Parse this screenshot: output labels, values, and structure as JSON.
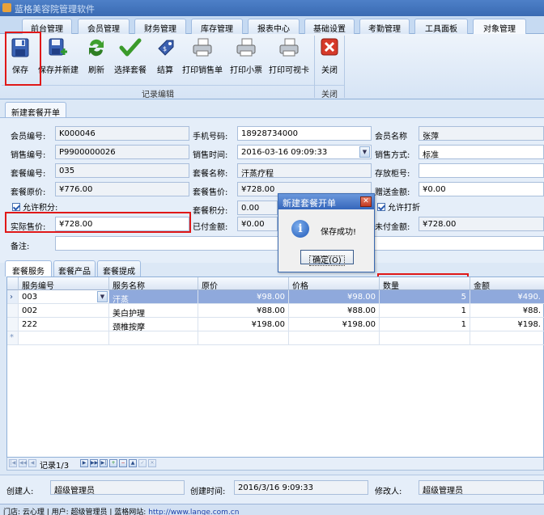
{
  "window": {
    "title": "蓝格美容院管理软件"
  },
  "menu_tabs": [
    "前台管理",
    "会员管理",
    "财务管理",
    "库存管理",
    "报表中心",
    "基础设置",
    "考勤管理",
    "工具面板",
    "对象管理"
  ],
  "ribbon": {
    "buttons": [
      {
        "label": "保存",
        "icon": "save-icon"
      },
      {
        "label": "保存并新建",
        "icon": "save-new-icon"
      },
      {
        "label": "刷新",
        "icon": "refresh-icon"
      },
      {
        "label": "选择套餐",
        "icon": "check-icon"
      },
      {
        "label": "结算",
        "icon": "settle-tag-icon"
      },
      {
        "label": "打印销售单",
        "icon": "printer-icon"
      },
      {
        "label": "打印小票",
        "icon": "printer-icon"
      },
      {
        "label": "打印可视卡",
        "icon": "printer-icon"
      },
      {
        "label": "关闭",
        "icon": "close-icon"
      }
    ],
    "groups": [
      "记录编辑",
      "关闭"
    ]
  },
  "doc_tab": "新建套餐开单",
  "form": {
    "member_no": {
      "label": "会员编号:",
      "value": "K000046"
    },
    "phone": {
      "label": "手机号码:",
      "value": "18928734000"
    },
    "member_name": {
      "label": "会员名称",
      "value": "张萍"
    },
    "sale_no": {
      "label": "销售编号:",
      "value": "P9900000026"
    },
    "sale_time": {
      "label": "销售时间:",
      "value": "2016-03-16 09:09:33"
    },
    "sale_method": {
      "label": "销售方式:",
      "value": "标准"
    },
    "package_no": {
      "label": "套餐编号:",
      "value": "035"
    },
    "package_name": {
      "label": "套餐名称:",
      "value": "汗蒸疗程"
    },
    "cabinet_no": {
      "label": "存放柜号:",
      "value": ""
    },
    "orig_price": {
      "label": "套餐原价:",
      "value": "¥776.00"
    },
    "sale_price": {
      "label": "套餐售价:",
      "value": "¥728.00"
    },
    "gift_amount": {
      "label": "赠送金额:",
      "value": "¥0.00"
    },
    "allow_points": {
      "label": "允许积分:"
    },
    "package_points": {
      "label": "套餐积分:",
      "value": "0.00"
    },
    "allow_discount": {
      "label": "允许打折"
    },
    "actual_price": {
      "label": "实际售价:",
      "value": "¥728.00"
    },
    "paid_amount": {
      "label": "已付金额:",
      "value": "¥0.00"
    },
    "unpaid_amount": {
      "label": "未付金额:",
      "value": "¥728.00"
    },
    "remark": {
      "label": "备注:",
      "value": ""
    }
  },
  "sub_tabs": [
    "套餐服务",
    "套餐产品",
    "套餐提成"
  ],
  "grid": {
    "columns": [
      "服务编号",
      "服务名称",
      "原价",
      "价格",
      "数量",
      "金额"
    ],
    "rows": [
      {
        "code": "003",
        "name": "汗蒸",
        "orig": "¥98.00",
        "price": "¥98.00",
        "qty": "5",
        "amount": "¥490."
      },
      {
        "code": "002",
        "name": "美白护理",
        "orig": "¥88.00",
        "price": "¥88.00",
        "qty": "1",
        "amount": "¥88."
      },
      {
        "code": "222",
        "name": "颈椎按摩",
        "orig": "¥198.00",
        "price": "¥198.00",
        "qty": "1",
        "amount": "¥198."
      }
    ]
  },
  "navigator": {
    "record_text": "记录1/3"
  },
  "footer": {
    "creator": {
      "label": "创建人:",
      "value": "超级管理员"
    },
    "created_time": {
      "label": "创建时间:",
      "value": "2016/3/16 9:09:33"
    },
    "modifier": {
      "label": "修改人:",
      "value": "超级管理员"
    }
  },
  "status_bar": {
    "text": "门店: 云心理 | 用户: 超级管理员 | 蓝格网站: ",
    "url": "http://www.lange.com.cn"
  },
  "dialog": {
    "title": "新建套餐开单",
    "message": "保存成功!",
    "ok_label": "确定(O)"
  },
  "colors": {
    "highlight": "#e01818",
    "selection": "#8fa9dc",
    "accent": "#3a6ab2"
  }
}
